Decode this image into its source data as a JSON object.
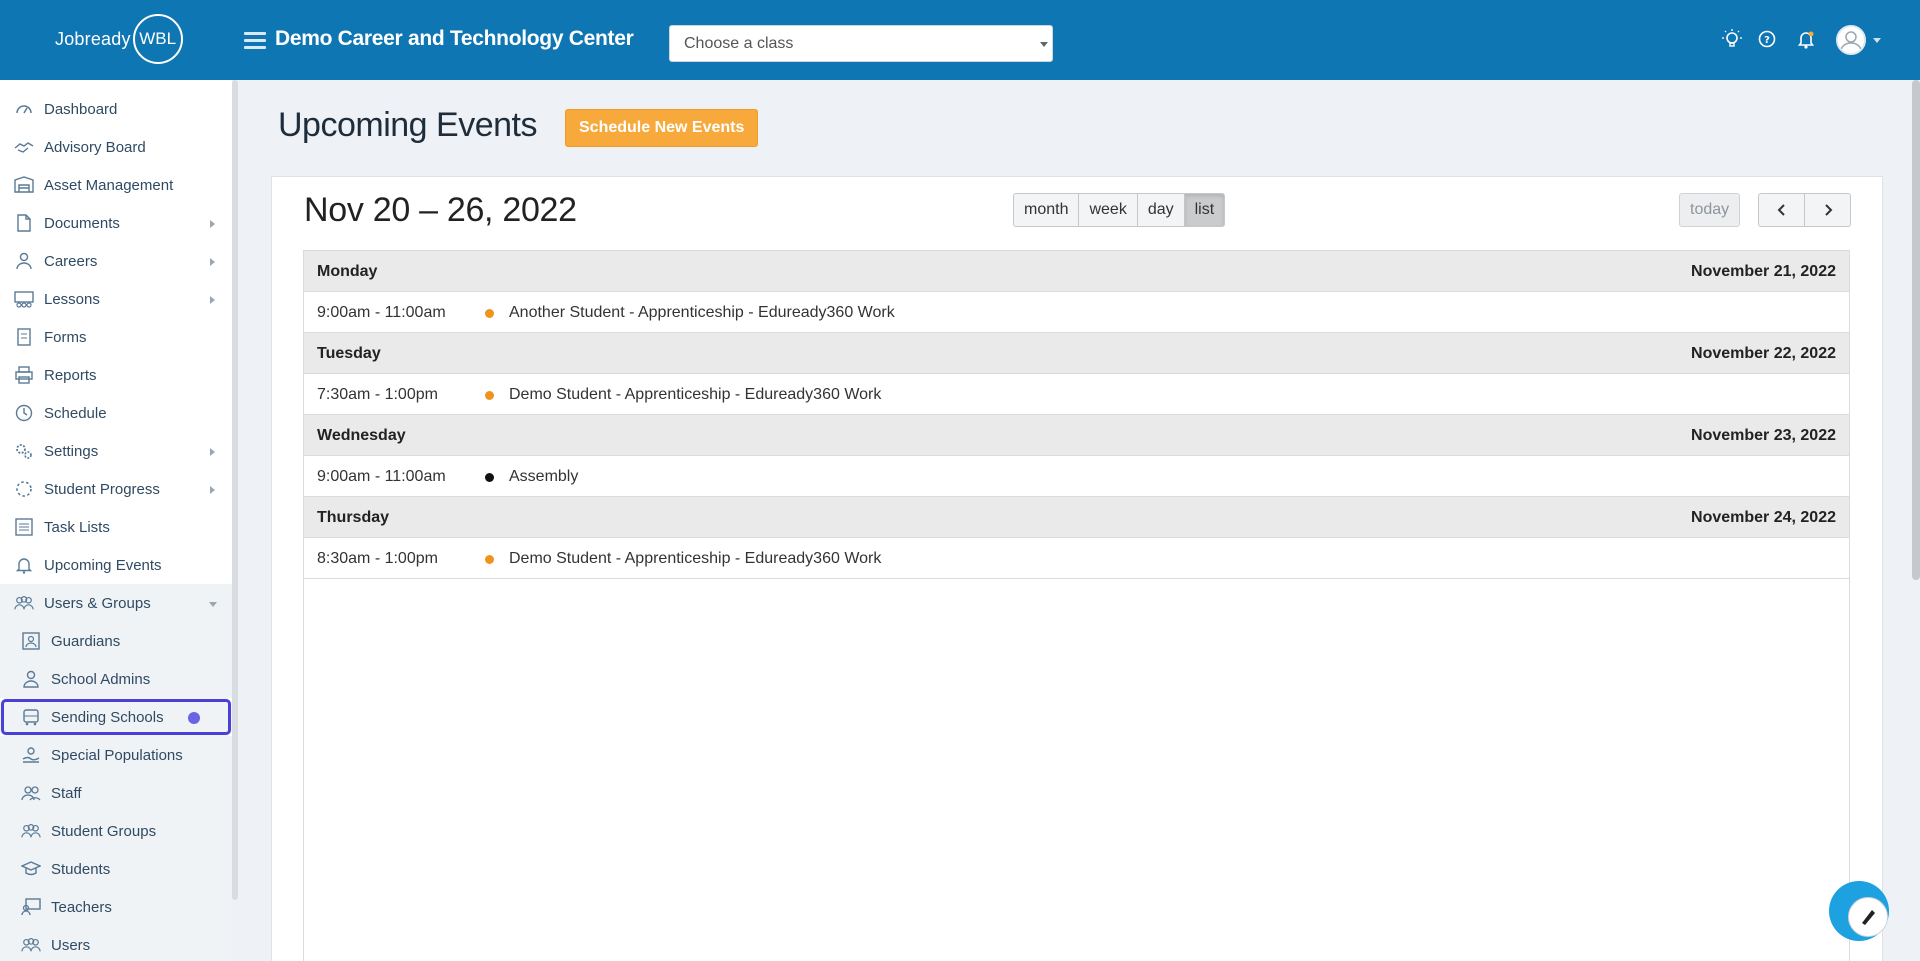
{
  "brand": {
    "logo_text": "Jobready",
    "logo_badge": "WBL"
  },
  "header": {
    "org_title": "Demo Career and Technology Center",
    "class_select_placeholder": "Choose a class",
    "icons": [
      "lightbulb-icon",
      "help-icon",
      "bell-icon",
      "user-avatar-icon"
    ]
  },
  "sidebar": {
    "items": [
      {
        "label": "Dashboard",
        "icon": "dashboard-icon",
        "has_children": false
      },
      {
        "label": "Advisory Board",
        "icon": "handshake-icon",
        "has_children": false
      },
      {
        "label": "Asset Management",
        "icon": "warehouse-icon",
        "has_children": false
      },
      {
        "label": "Documents",
        "icon": "document-icon",
        "has_children": true
      },
      {
        "label": "Careers",
        "icon": "career-icon",
        "has_children": true
      },
      {
        "label": "Lessons",
        "icon": "lessons-icon",
        "has_children": true
      },
      {
        "label": "Forms",
        "icon": "form-icon",
        "has_children": false
      },
      {
        "label": "Reports",
        "icon": "printer-icon",
        "has_children": false
      },
      {
        "label": "Schedule",
        "icon": "clock-icon",
        "has_children": false
      },
      {
        "label": "Settings",
        "icon": "gears-icon",
        "has_children": true
      },
      {
        "label": "Student Progress",
        "icon": "progress-icon",
        "has_children": true
      },
      {
        "label": "Task Lists",
        "icon": "list-icon",
        "has_children": false
      },
      {
        "label": "Upcoming Events",
        "icon": "bell-icon",
        "has_children": false
      },
      {
        "label": "Users & Groups",
        "icon": "users-icon",
        "has_children": true,
        "expanded": true
      }
    ],
    "sub_items": [
      {
        "label": "Guardians",
        "icon": "guardian-icon"
      },
      {
        "label": "School Admins",
        "icon": "user-icon"
      },
      {
        "label": "Sending Schools",
        "icon": "bus-icon",
        "highlighted": true
      },
      {
        "label": "Special Populations",
        "icon": "hand-user-icon"
      },
      {
        "label": "Staff",
        "icon": "staff-icon"
      },
      {
        "label": "Student Groups",
        "icon": "group-icon"
      },
      {
        "label": "Students",
        "icon": "graduation-cap-icon"
      },
      {
        "label": "Teachers",
        "icon": "teacher-icon"
      },
      {
        "label": "Users",
        "icon": "users-icon"
      }
    ]
  },
  "main": {
    "page_title": "Upcoming Events",
    "schedule_button": "Schedule New Events",
    "calendar": {
      "range_title": "Nov 20 – 26, 2022",
      "views": [
        "month",
        "week",
        "day",
        "list"
      ],
      "active_view": "list",
      "today_label": "today",
      "days": [
        {
          "name": "Monday",
          "date": "November 21, 2022",
          "events": [
            {
              "time": "9:00am - 11:00am",
              "title": "Another Student - Apprenticeship - Eduready360 Work",
              "color": "#f0931e"
            }
          ]
        },
        {
          "name": "Tuesday",
          "date": "November 22, 2022",
          "events": [
            {
              "time": "7:30am - 1:00pm",
              "title": "Demo Student - Apprenticeship - Eduready360 Work",
              "color": "#f0931e"
            }
          ]
        },
        {
          "name": "Wednesday",
          "date": "November 23, 2022",
          "events": [
            {
              "time": "9:00am - 11:00am",
              "title": "Assembly",
              "color": "#111111"
            }
          ]
        },
        {
          "name": "Thursday",
          "date": "November 24, 2022",
          "events": [
            {
              "time": "8:30am - 1:00pm",
              "title": "Demo Student - Apprenticeship - Eduready360 Work",
              "color": "#f0931e"
            }
          ]
        }
      ]
    }
  },
  "colors": {
    "topbar": "#0f76b4",
    "accent_button": "#f7a93b",
    "highlight": "#4a3fd6"
  }
}
